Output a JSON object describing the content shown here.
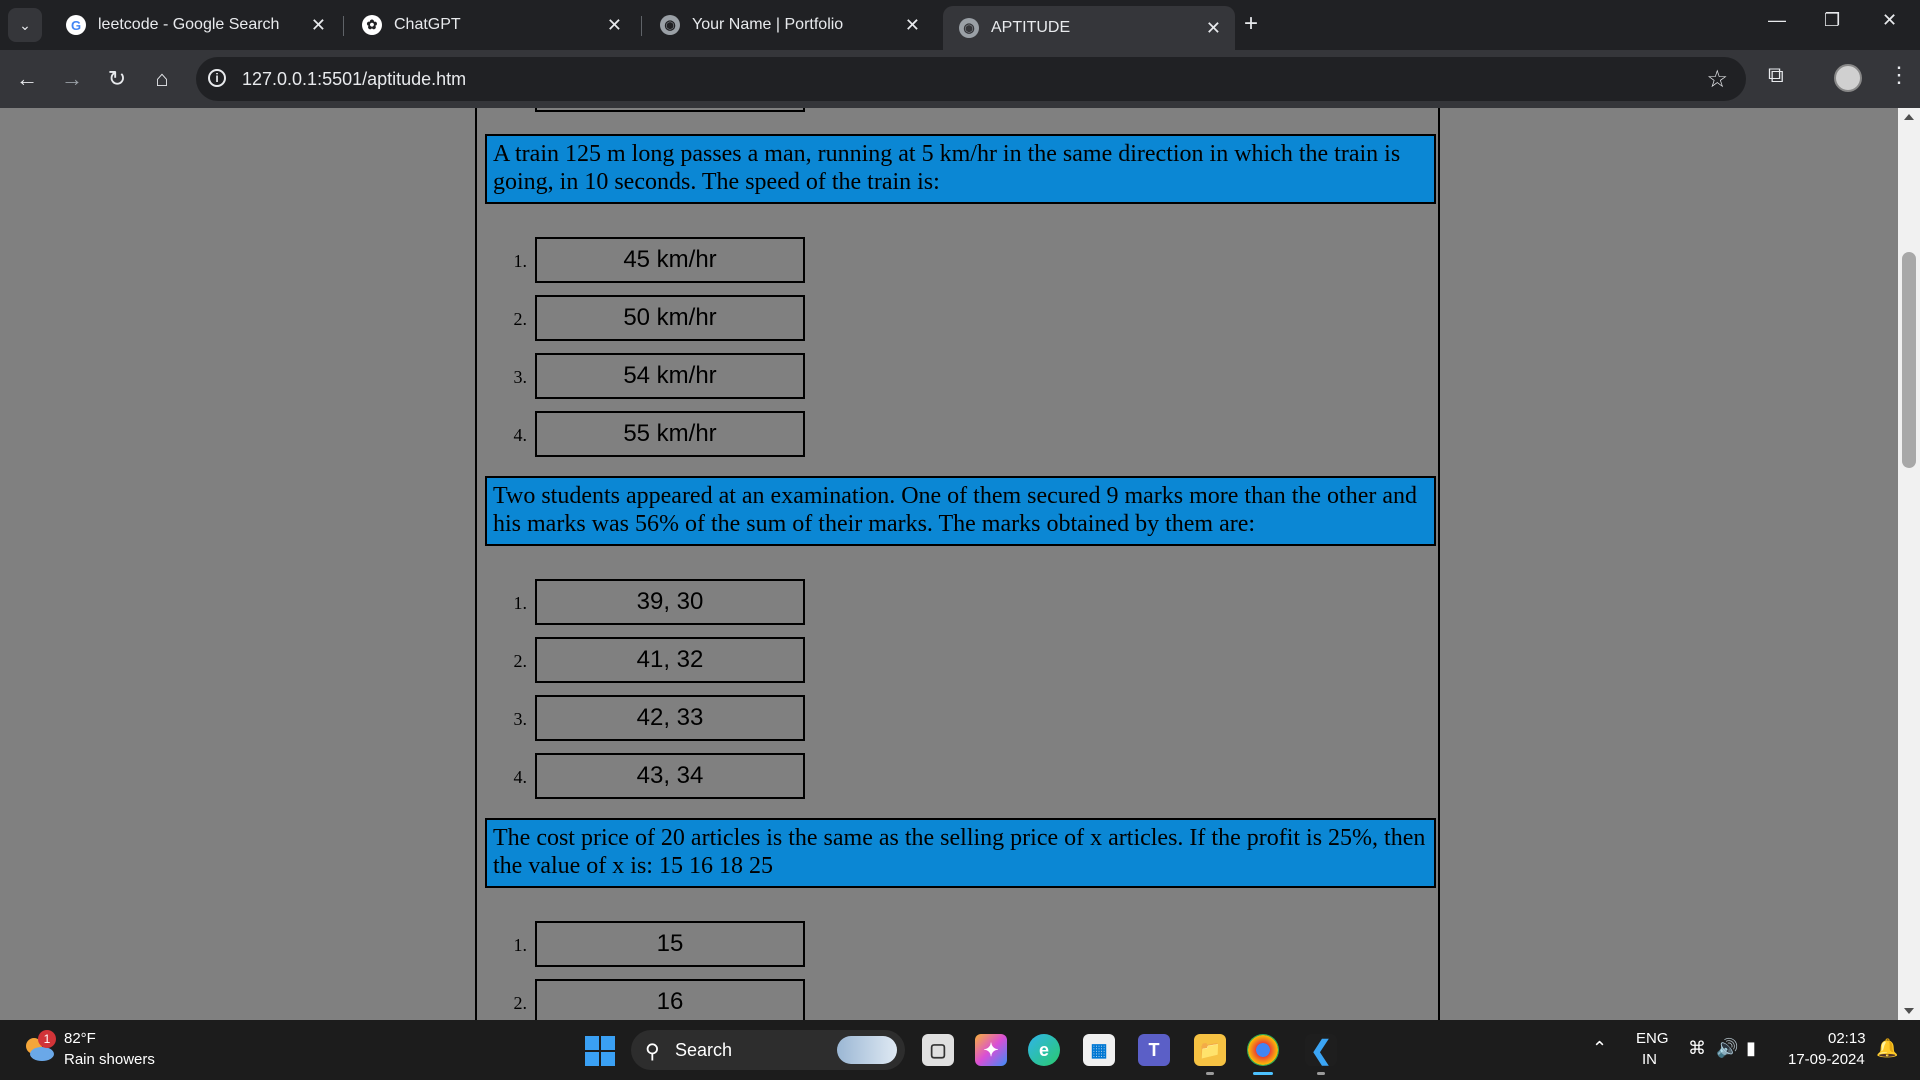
{
  "browser": {
    "tabs": [
      {
        "title": "leetcode - Google Search",
        "icon": "google-icon"
      },
      {
        "title": "ChatGPT",
        "icon": "chatgpt-icon"
      },
      {
        "title": "Your Name | Portfolio",
        "icon": "globe-icon"
      },
      {
        "title": "APTITUDE",
        "icon": "globe-icon",
        "active": true
      }
    ],
    "url": "127.0.0.1:5501/aptitude.htm"
  },
  "page": {
    "questions": [
      {
        "text": "A train 125 m long passes a man, running at 5 km/hr in the same direction in which the train is going, in 10 seconds. The speed of the train is:",
        "options": [
          {
            "num": "1.",
            "text": "45 km/hr"
          },
          {
            "num": "2.",
            "text": "50 km/hr"
          },
          {
            "num": "3.",
            "text": "54 km/hr"
          },
          {
            "num": "4.",
            "text": "55 km/hr"
          }
        ]
      },
      {
        "text": "Two students appeared at an examination. One of them secured 9 marks more than the other and his marks was 56% of the sum of their marks. The marks obtained by them are:",
        "options": [
          {
            "num": "1.",
            "text": "39, 30"
          },
          {
            "num": "2.",
            "text": "41, 32"
          },
          {
            "num": "3.",
            "text": "42, 33"
          },
          {
            "num": "4.",
            "text": "43, 34"
          }
        ]
      },
      {
        "text": "The cost price of 20 articles is the same as the selling price of x articles. If the profit is 25%, then the value of x is: 15 16 18 25",
        "options": [
          {
            "num": "1.",
            "text": "15"
          },
          {
            "num": "2.",
            "text": "16"
          }
        ]
      }
    ],
    "colors": {
      "question_bg": "#0b87d4",
      "page_bg": "#808080"
    }
  },
  "taskbar": {
    "weather": {
      "badge": "1",
      "temp": "82°F",
      "desc": "Rain showers"
    },
    "search_label": "Search",
    "language": {
      "line1": "ENG",
      "line2": "IN"
    },
    "clock": {
      "time": "02:13",
      "date": "17-09-2024"
    }
  }
}
